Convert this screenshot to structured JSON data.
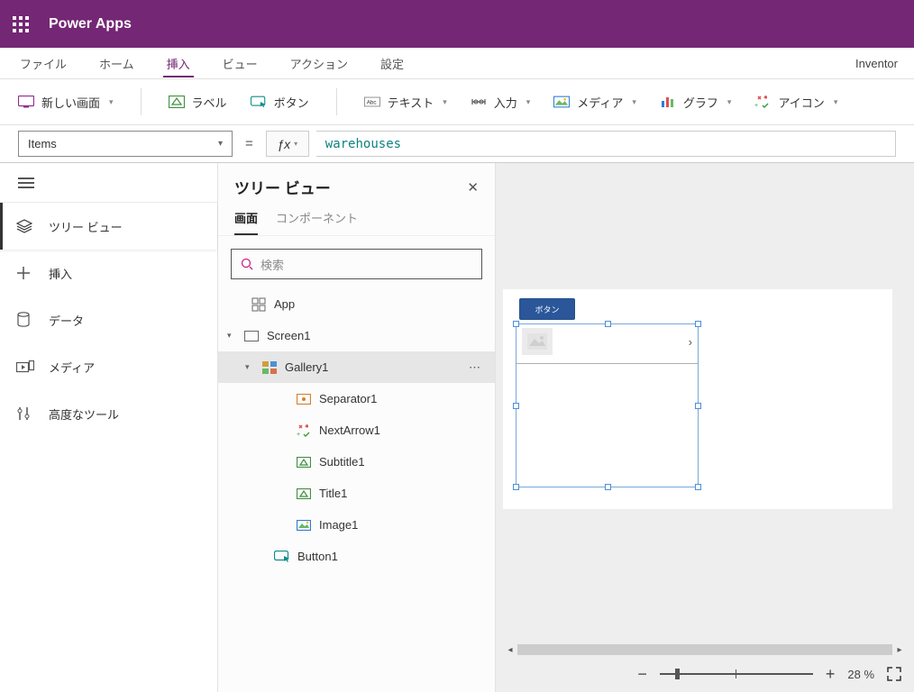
{
  "title": "Power Apps",
  "env_name": "Inventor",
  "menubar": [
    "ファイル",
    "ホーム",
    "挿入",
    "ビュー",
    "アクション",
    "設定"
  ],
  "menubar_active_index": 2,
  "ribbon": {
    "newscreen": "新しい画面",
    "label": "ラベル",
    "button": "ボタン",
    "text": "テキスト",
    "input": "入力",
    "media": "メディア",
    "chart": "グラフ",
    "icon": "アイコン"
  },
  "formula": {
    "property": "Items",
    "value": "warehouses"
  },
  "rail": {
    "items": [
      {
        "label": "ツリー ビュー",
        "icon": "layers"
      },
      {
        "label": "挿入",
        "icon": "plus"
      },
      {
        "label": "データ",
        "icon": "cylinder"
      },
      {
        "label": "メディア",
        "icon": "media"
      },
      {
        "label": "高度なツール",
        "icon": "tools"
      }
    ],
    "active_index": 0
  },
  "tree": {
    "title": "ツリー ビュー",
    "tabs": [
      "画面",
      "コンポーネント"
    ],
    "active_tab": 0,
    "search_placeholder": "検索",
    "nodes": {
      "app": "App",
      "screen": "Screen1",
      "gallery": "Gallery1",
      "separator": "Separator1",
      "nextarrow": "NextArrow1",
      "subtitle": "Subtitle1",
      "titlelbl": "Title1",
      "image": "Image1",
      "button": "Button1"
    }
  },
  "canvas": {
    "button_text": "ボタン"
  },
  "zoom": {
    "value": "28",
    "unit": "%"
  }
}
